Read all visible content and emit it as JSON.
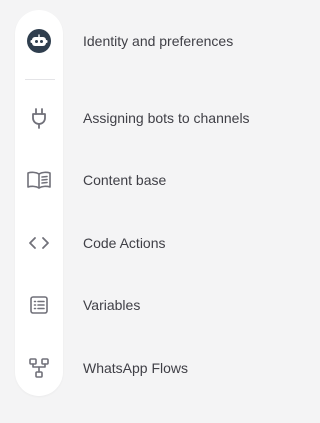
{
  "nav": {
    "items": [
      {
        "key": "identity",
        "label": "Identity and preferences",
        "icon": "bot-icon"
      },
      {
        "key": "channels",
        "label": "Assigning bots to channels",
        "icon": "plug-icon"
      },
      {
        "key": "content",
        "label": "Content base",
        "icon": "book-icon"
      },
      {
        "key": "code",
        "label": "Code Actions",
        "icon": "code-icon"
      },
      {
        "key": "variables",
        "label": "Variables",
        "icon": "list-icon"
      },
      {
        "key": "flows",
        "label": "WhatsApp Flows",
        "icon": "flow-icon"
      }
    ]
  },
  "colors": {
    "background": "#f4f4f5",
    "rail": "#ffffff",
    "icon": "#71717a",
    "bot_badge": "#2f3e4e",
    "text": "#3f3f46"
  }
}
